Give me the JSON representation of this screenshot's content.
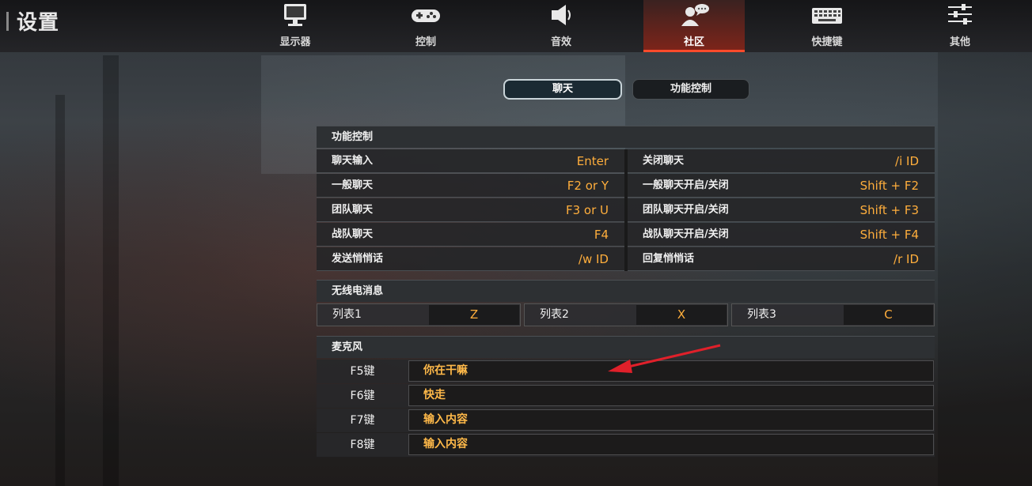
{
  "header": {
    "title": "设置",
    "tabs": [
      {
        "label": "显示器",
        "icon": "monitor-icon"
      },
      {
        "label": "控制",
        "icon": "gamepad-icon"
      },
      {
        "label": "音效",
        "icon": "speaker-icon"
      },
      {
        "label": "社区",
        "icon": "community-chat-icon"
      },
      {
        "label": "快捷键",
        "icon": "keyboard-icon"
      },
      {
        "label": "其他",
        "icon": "sliders-icon"
      }
    ],
    "active_tab": "社区"
  },
  "subtabs": {
    "chat": "聊天",
    "function_control": "功能控制",
    "active": "聊天"
  },
  "function_control": {
    "title": "功能控制",
    "left": [
      {
        "label": "聊天输入",
        "key": "Enter"
      },
      {
        "label": "一般聊天",
        "key": "F2 or Y"
      },
      {
        "label": "团队聊天",
        "key": "F3 or U"
      },
      {
        "label": "战队聊天",
        "key": "F4"
      },
      {
        "label": "发送悄悄话",
        "key": "/w ID"
      }
    ],
    "right": [
      {
        "label": "关闭聊天",
        "key": "/i ID"
      },
      {
        "label": "一般聊天开启/关闭",
        "key": "Shift + F2"
      },
      {
        "label": "团队聊天开启/关闭",
        "key": "Shift + F3"
      },
      {
        "label": "战队聊天开启/关闭",
        "key": "Shift + F4"
      },
      {
        "label": "回复悄悄话",
        "key": "/r ID"
      }
    ]
  },
  "radio": {
    "title": "无线电消息",
    "items": [
      {
        "label": "列表1",
        "key": "Z"
      },
      {
        "label": "列表2",
        "key": "X"
      },
      {
        "label": "列表3",
        "key": "C"
      }
    ]
  },
  "microphone": {
    "title": "麦克风",
    "rows": [
      {
        "key": "F5键",
        "text": "你在干嘛"
      },
      {
        "key": "F6键",
        "text": "快走"
      },
      {
        "key": "F7键",
        "text": "输入内容"
      },
      {
        "key": "F8键",
        "text": "输入内容"
      }
    ]
  },
  "colors": {
    "accent": "#ff4b2b",
    "key_value": "#ffae3c",
    "annotation_arrow": "#e0202a"
  }
}
